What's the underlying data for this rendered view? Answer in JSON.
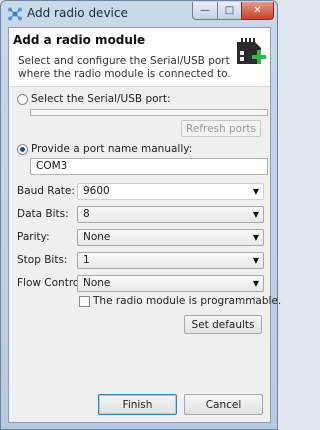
{
  "window": {
    "title": "Add radio device",
    "controls": {
      "minimize": "—",
      "maximize": "□",
      "close": "✕"
    }
  },
  "header": {
    "title": "Add a radio module",
    "description": "Select and configure the Serial/USB port where the radio module is connected to.",
    "icon": "radio-module-add-icon"
  },
  "port_selection": {
    "select_port_label": "Select the Serial/USB port:",
    "refresh_button": "Refresh ports",
    "manual_label": "Provide a port name manually:",
    "manual_value": "COM3",
    "selected_option": "manual"
  },
  "settings": {
    "baud_rate": {
      "label": "Baud Rate:",
      "value": "9600"
    },
    "data_bits": {
      "label": "Data Bits:",
      "value": "8"
    },
    "parity": {
      "label": "Parity:",
      "value": "None"
    },
    "stop_bits": {
      "label": "Stop Bits:",
      "value": "1"
    },
    "flow_control": {
      "label": "Flow Control:",
      "value": "None"
    }
  },
  "programmable": {
    "label": "The radio module is programmable.",
    "checked": false
  },
  "set_defaults_button": "Set defaults",
  "footer": {
    "finish": "Finish",
    "cancel": "Cancel"
  },
  "colors": {
    "accent_green": "#39b54a",
    "title_bar": "#c9d9ea"
  }
}
